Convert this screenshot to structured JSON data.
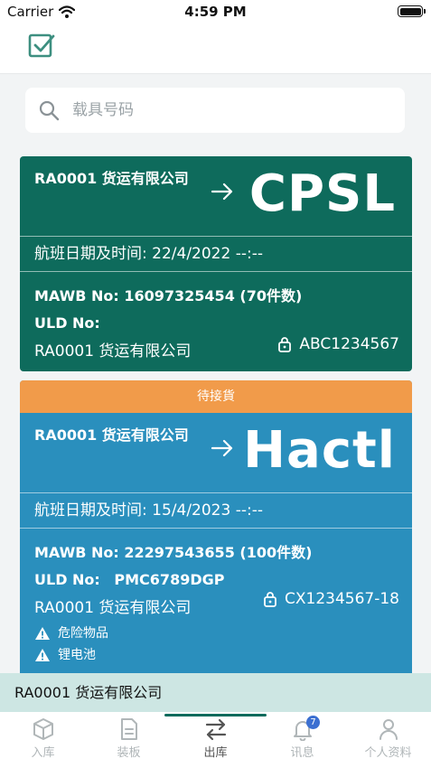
{
  "status_bar": {
    "carrier": "Carrier",
    "time": "4:59 PM"
  },
  "search": {
    "placeholder": "载具号码"
  },
  "cards": [
    {
      "shipper": "RA0001 货运有限公司",
      "destination": "CPSL",
      "flight_label": "航班日期及时间:",
      "flight_value": "22/4/2022 --:--",
      "mawb_label": "MAWB No:",
      "mawb_value": "16097325454 (70件数)",
      "uld_label": "ULD No:",
      "uld_value": "",
      "company": "RA0001 货运有限公司",
      "uld_code": "ABC1234567",
      "color": "#0e6b5c"
    },
    {
      "status": "待接貨",
      "shipper": "RA0001 货运有限公司",
      "destination": "Hactl",
      "flight_label": "航班日期及时间:",
      "flight_value": "15/4/2023 --:--",
      "mawb_label": "MAWB No:",
      "mawb_value": "22297543655 (100件数)",
      "uld_label": "ULD No:",
      "uld_value": "PMC6789DGP",
      "company": "RA0001 货运有限公司",
      "uld_code": "CX1234567-18",
      "warnings": [
        "危险物品",
        "锂电池"
      ],
      "color": "#2a8fbd",
      "status_color": "#f19b4a"
    }
  ],
  "footer_company": "RA0001 货运有限公司",
  "tabs": [
    {
      "label": "入库",
      "icon": "box-icon"
    },
    {
      "label": "装板",
      "icon": "document-icon"
    },
    {
      "label": "出库",
      "icon": "swap-icon",
      "active": true
    },
    {
      "label": "讯息",
      "icon": "bell-icon",
      "badge": "7"
    },
    {
      "label": "个人资料",
      "icon": "person-icon"
    }
  ],
  "accent_color": "#0e6b5c"
}
